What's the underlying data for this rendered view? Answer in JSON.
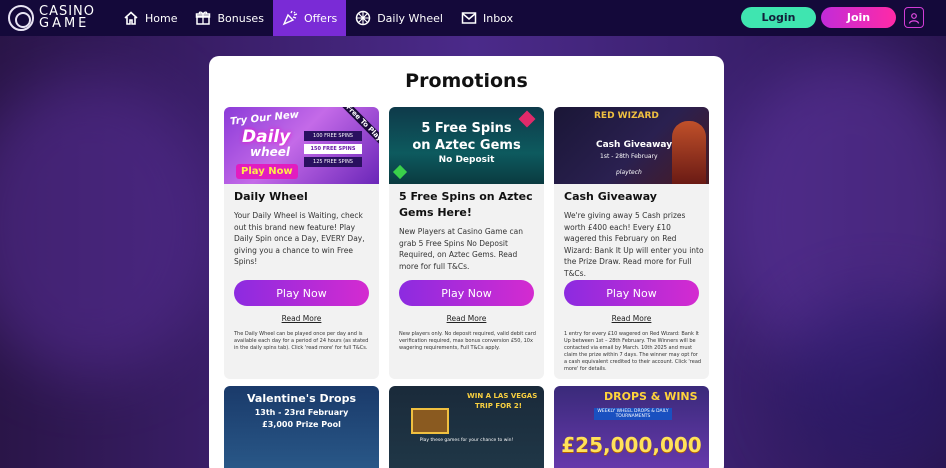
{
  "header": {
    "logo_text_1": "CASINO",
    "logo_text_2": "GAME",
    "nav": [
      {
        "label": "Home",
        "icon": "home-icon"
      },
      {
        "label": "Bonuses",
        "icon": "gift-icon"
      },
      {
        "label": "Offers",
        "icon": "party-popper-icon"
      },
      {
        "label": "Daily Wheel",
        "icon": "wheel-icon"
      },
      {
        "label": "Inbox",
        "icon": "envelope-icon"
      }
    ],
    "active_nav": "Offers",
    "login_label": "Login",
    "join_label": "Join"
  },
  "main": {
    "title": "Promotions",
    "cards": [
      {
        "banner": {
          "line1": "Try Our New",
          "line2": "Daily",
          "line3": "wheel",
          "ribbon": "Free To Play",
          "cta": "Play Now",
          "rows": [
            "100 FREE SPINS",
            "150 FREE SPINS",
            "125 FREE SPINS"
          ]
        },
        "title": "Daily Wheel",
        "desc": "Your Daily Wheel is Waiting, check out this brand new feature! Play Daily Spin once a Day, EVERY Day, giving you a chance to win Free Spins!",
        "button": "Play Now",
        "read_more": "Read More",
        "small": "The Daily Wheel can be played once per day and is available each day for a period of 24 hours (as stated in the daily spins tab). Click 'read more' for full T&Cs."
      },
      {
        "banner": {
          "line1": "5 Free Spins",
          "line2": "on Aztec Gems",
          "line3": "No Deposit"
        },
        "title": "5 Free Spins on Aztec Gems Here!",
        "desc": "New Players at Casino Game can grab 5 Free Spins No Deposit Required, on Aztec Gems. Read more for full T&Cs.",
        "button": "Play Now",
        "read_more": "Read More",
        "small": "New players only. No deposit required, valid debit card verification required, max bonus conversion £50, 10x wagering requirements, Full T&Cs apply."
      },
      {
        "banner": {
          "line1": "RED WIZARD",
          "line2": "Cash Giveaway",
          "line3": "1st - 28th February",
          "brand": "playtech"
        },
        "title": "Cash Giveaway",
        "desc": "We're giving away 5 Cash prizes worth £400 each! Every £10 wagered this February on Red Wizard: Bank It Up will enter you into the Prize Draw. Read more for Full T&Cs.",
        "button": "Play Now",
        "read_more": "Read More",
        "small": "1 entry for every £10 wagered on Red Wizard: Bank It Up between 1st – 28th February. The Winners will be contacted via email by March. 10th 2025 and must claim the prize within 7 days. The winner may opt for a cash equivalent credited to their account. Click 'read more' for details."
      }
    ],
    "bottom_cards": [
      {
        "line1": "Valentine's Drops",
        "line2": "13th - 23rd February",
        "line3": "£3,000 Prize Pool"
      },
      {
        "line1": "WIN A LAS VEGAS",
        "line2": "TRIP FOR 2!",
        "line3": "Play these games for your chance to win!"
      },
      {
        "line1": "DROPS & WINS",
        "line2": "£25,000,000",
        "line3": "WEEKLY WHEEL DROPS & DAILY TOURNAMENTS"
      }
    ]
  },
  "colors": {
    "topbar": "#14093a",
    "active_nav": "#7a2bd6",
    "login": "#3fe5b0",
    "join_start": "#c22bd9",
    "join_end": "#ff2aa6",
    "play_start": "#8c2be0",
    "play_end": "#d42bd0"
  }
}
